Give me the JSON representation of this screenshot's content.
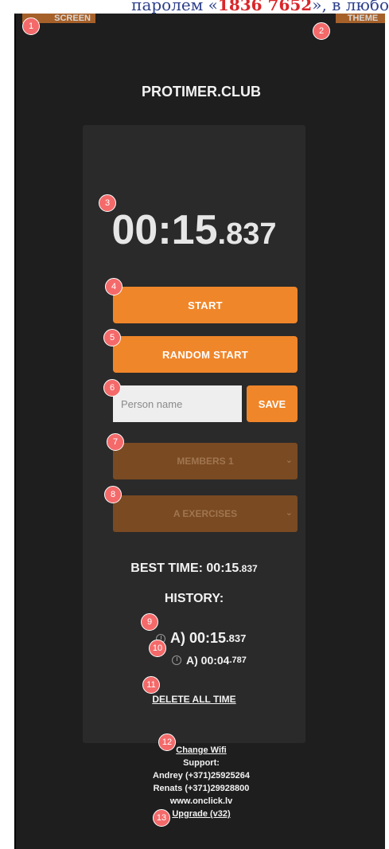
{
  "top_strip": {
    "text_before": "паролем «",
    "code": "1836 7652",
    "text_after": "», в любо"
  },
  "header": {
    "screen_label": "SCREEN",
    "theme_label": "THEME"
  },
  "brand": "PROTIMER.CLUB",
  "timer": {
    "main": "00:15",
    "ms": ".837"
  },
  "buttons": {
    "start": "START",
    "random_start": "RANDOM START",
    "save": "SAVE"
  },
  "person_input": {
    "placeholder": "Person name",
    "value": ""
  },
  "members_select": {
    "value": "MEMBERS 1"
  },
  "exercises_select": {
    "value": "A EXERCISES"
  },
  "best_time": {
    "label": "BEST TIME: 00:15",
    "ms": ".837"
  },
  "history": {
    "title": "HISTORY:",
    "items": [
      {
        "main": "A) 00:15",
        "ms": ".837"
      },
      {
        "main": "A) 00:04",
        "ms": ".787"
      }
    ]
  },
  "delete_label": "DELETE ALL TIME",
  "footer": {
    "change_wifi": "Change Wifi",
    "support": "Support:",
    "contact1": "Andrey (+371)25925264",
    "contact2": "Renats (+371)29928800",
    "website": "www.onclick.lv",
    "upgrade": "Upgrade (v32)"
  },
  "badges": [
    "1",
    "2",
    "3",
    "4",
    "5",
    "6",
    "7",
    "8",
    "9",
    "10",
    "11",
    "12",
    "13"
  ],
  "colors": {
    "accent": "#f0862a",
    "select_bg": "#7a4a22",
    "bg": "#1e1e1e",
    "card": "#2a2a2a",
    "badge": "#f46a6a"
  }
}
